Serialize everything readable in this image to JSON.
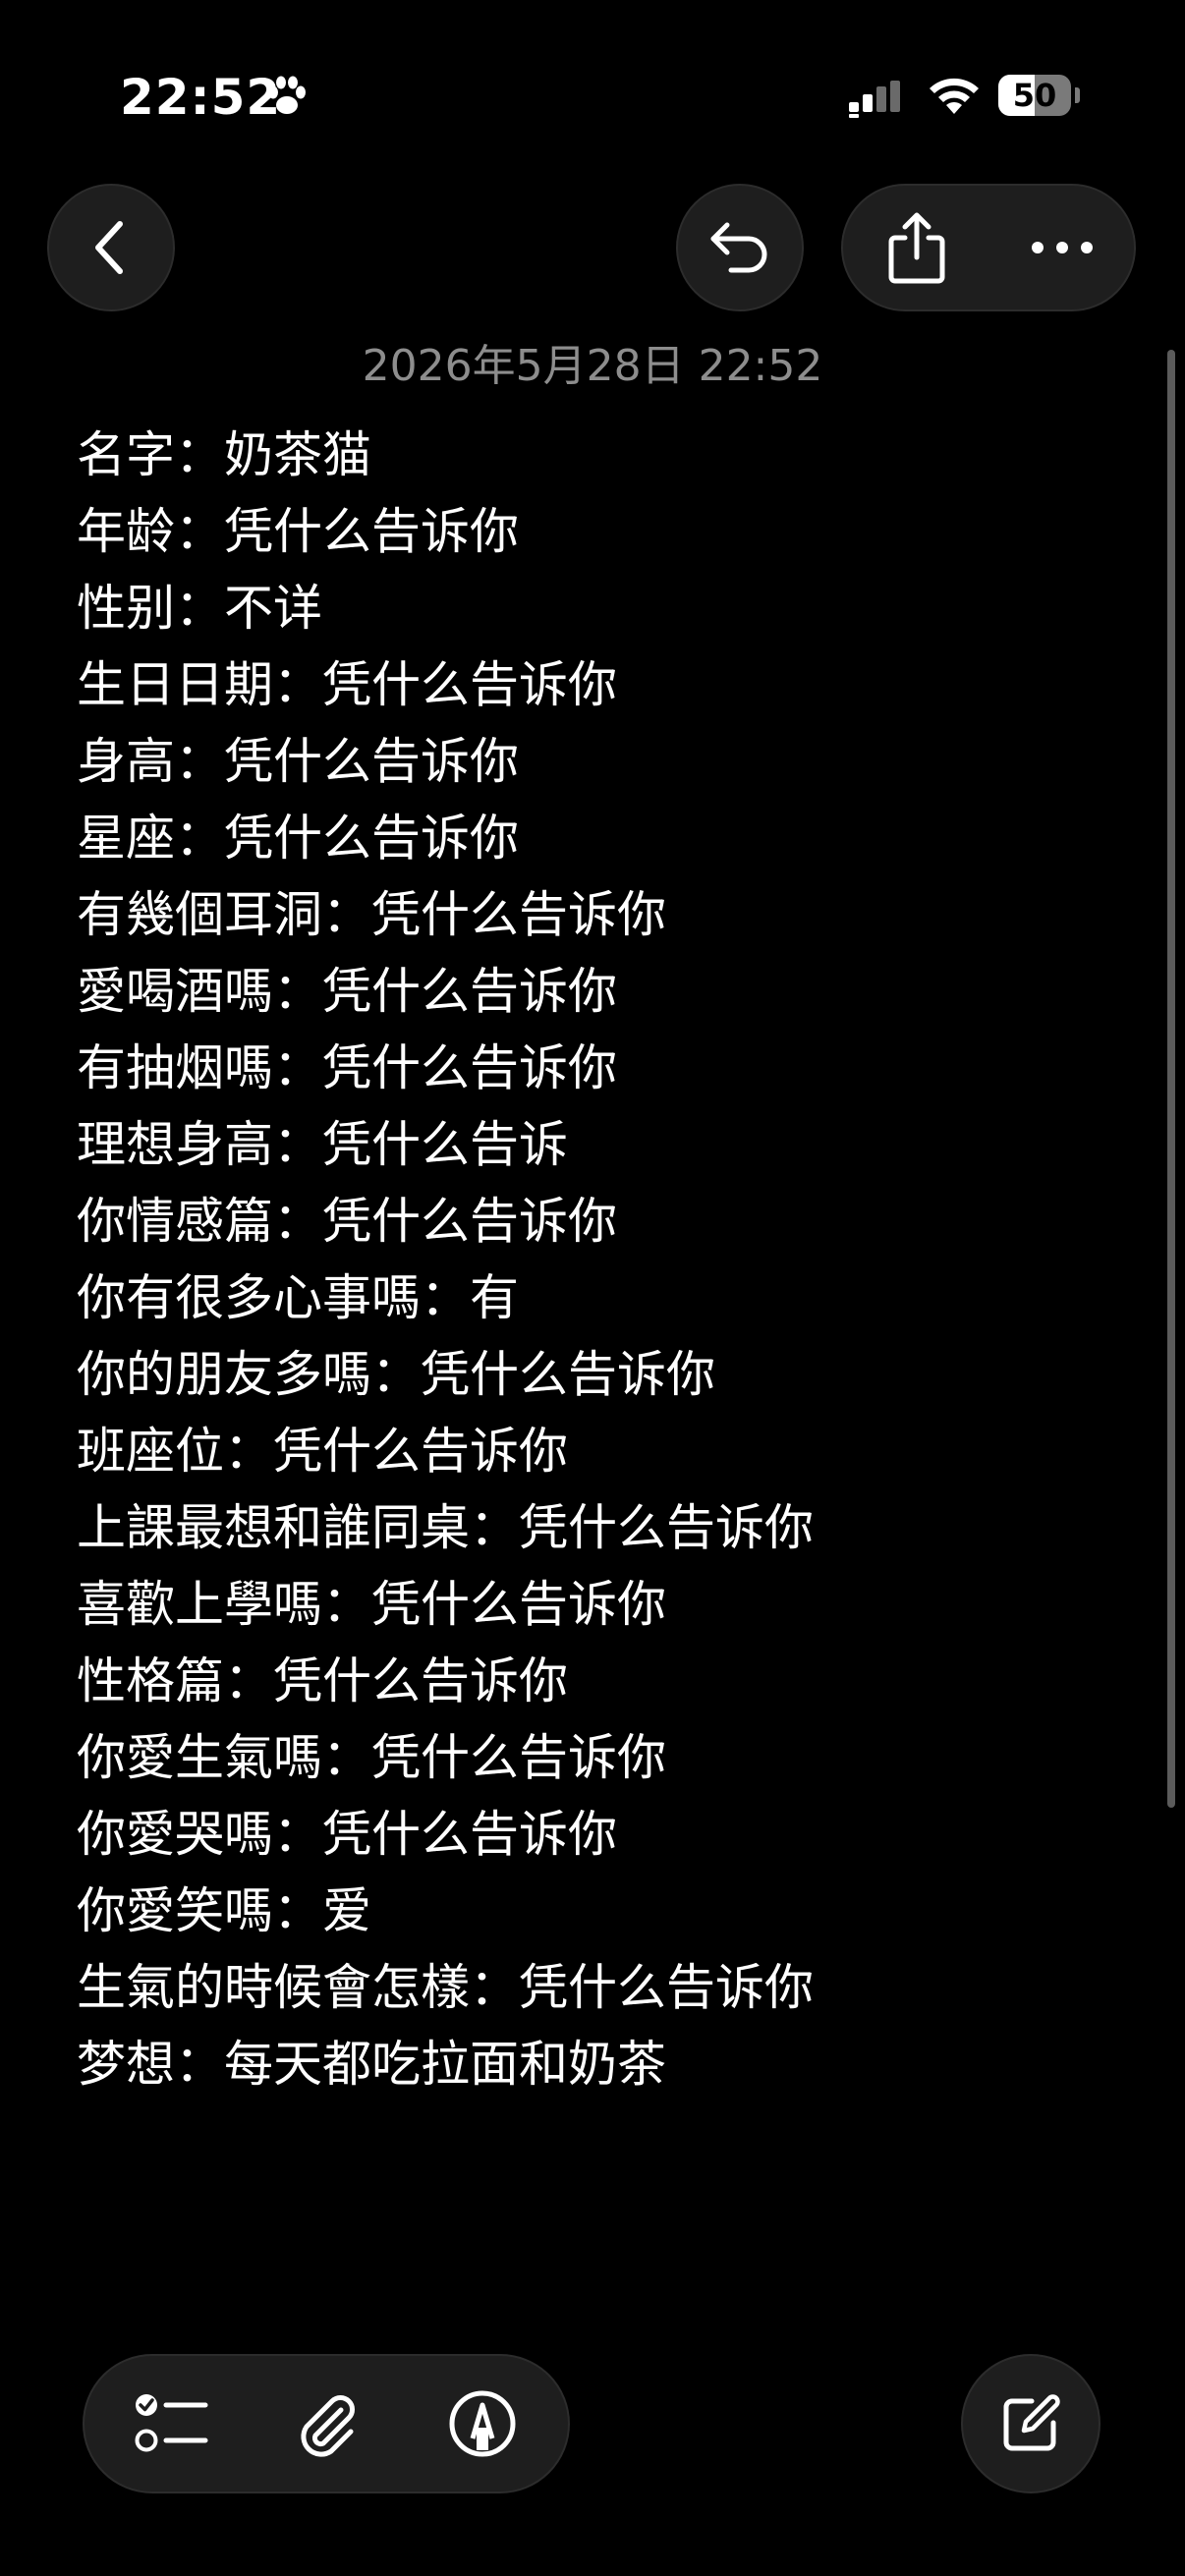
{
  "status_bar": {
    "time": "22:52",
    "battery_level": "50",
    "battery_fraction": 0.5,
    "icons": [
      "paw-icon",
      "cellular-signal-icon",
      "wifi-icon",
      "battery-icon"
    ]
  },
  "nav": {
    "icons": [
      "chevron-left-icon",
      "undo-icon",
      "share-icon",
      "ellipsis-icon"
    ]
  },
  "note": {
    "date": "2026年5月28日 22:52",
    "lines": [
      "名字：奶茶猫",
      "年龄：凭什么告诉你",
      "性别：不详",
      "生日日期：凭什么告诉你",
      "身高：凭什么告诉你",
      "星座：凭什么告诉你",
      "有幾個耳洞：凭什么告诉你",
      "愛喝酒嗎：凭什么告诉你",
      "有抽烟嗎：凭什么告诉你",
      "理想身高：凭什么告诉",
      "你情感篇：凭什么告诉你",
      "你有很多心事嗎：有",
      "你的朋友多嗎：凭什么告诉你",
      "班座位：凭什么告诉你",
      "上課最想和誰同桌：凭什么告诉你",
      "喜歡上學嗎：凭什么告诉你",
      "性格篇：凭什么告诉你",
      "你愛生氣嗎：凭什么告诉你",
      "你愛哭嗎：凭什么告诉你",
      "你愛笑嗎：爱",
      "生氣的時候會怎樣：凭什么告诉你",
      "梦想：每天都吃拉面和奶茶"
    ]
  },
  "toolbar": {
    "icons": [
      "checklist-icon",
      "paperclip-icon",
      "markup-pen-icon",
      "compose-icon"
    ]
  },
  "colors": {
    "background": "#000000",
    "text": "#ffffff",
    "muted_text": "#8d8d8d",
    "button_fill": "#1e1e1e"
  }
}
